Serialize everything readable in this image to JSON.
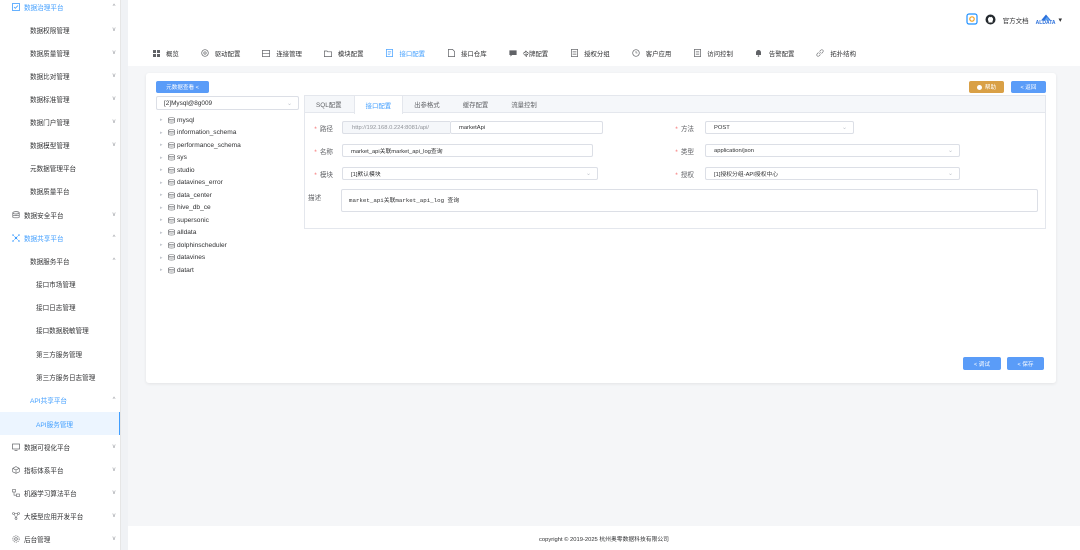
{
  "sidebar": {
    "items": [
      {
        "label": "数据治理平台",
        "icon": "checklist-icon",
        "chevron": "^"
      },
      {
        "label": "数据权限管理",
        "chevron": "v"
      },
      {
        "label": "数据质量管理",
        "chevron": "v"
      },
      {
        "label": "数据比对管理",
        "chevron": "v"
      },
      {
        "label": "数据标准管理",
        "chevron": "v"
      },
      {
        "label": "数据门户管理",
        "chevron": "v"
      },
      {
        "label": "数据模型管理",
        "chevron": "v"
      },
      {
        "label": "元数据管理平台",
        "chevron": ""
      },
      {
        "label": "数据质量平台",
        "chevron": ""
      },
      {
        "label": "数据安全平台",
        "icon": "database-icon",
        "chevron": "v"
      },
      {
        "label": "数据共享平台",
        "icon": "share-network-icon",
        "chevron": "^"
      },
      {
        "label": "数据服务平台",
        "chevron": "^"
      },
      {
        "label": "接口市场管理",
        "chevron": ""
      },
      {
        "label": "接口日志管理",
        "chevron": ""
      },
      {
        "label": "接口数据脱敏管理",
        "chevron": ""
      },
      {
        "label": "第三方服务管理",
        "chevron": ""
      },
      {
        "label": "第三方服务日志管理",
        "chevron": ""
      },
      {
        "label": "API共享平台",
        "chevron": "^"
      },
      {
        "label": "API服务管理",
        "chevron": ""
      },
      {
        "label": "数据可视化平台",
        "icon": "monitor-icon",
        "chevron": "v"
      },
      {
        "label": "指标体系平台",
        "icon": "cube-icon",
        "chevron": "v"
      },
      {
        "label": "机器学习算法平台",
        "icon": "flow-icon",
        "chevron": "v"
      },
      {
        "label": "大模型应用开发平台",
        "icon": "ai-network-icon",
        "chevron": "v"
      },
      {
        "label": "后台管理",
        "icon": "settings-icon",
        "chevron": "v"
      }
    ]
  },
  "header": {
    "docs_label": "官方文档",
    "logo_text": "ALDATA",
    "dropdown_arrow": "▾"
  },
  "tabs": [
    {
      "label": "概览"
    },
    {
      "label": "驱动配置"
    },
    {
      "label": "连接管理"
    },
    {
      "label": "模块配置"
    },
    {
      "label": "接口配置"
    },
    {
      "label": "接口仓库"
    },
    {
      "label": "令牌配置"
    },
    {
      "label": "授权分组"
    },
    {
      "label": "客户应用"
    },
    {
      "label": "访问控制"
    },
    {
      "label": "告警配置"
    },
    {
      "label": "拓扑结构"
    }
  ],
  "card": {
    "metadata_button": "元数据查看 <",
    "help_button": "帮助",
    "back_button": "< 返回",
    "datasource_select": "[2]Mysql@8g009",
    "tree": [
      "mysql",
      "information_schema",
      "performance_schema",
      "sys",
      "studio",
      "datavines_error",
      "data_center",
      "hive_db_ce",
      "supersonic",
      "alldata",
      "dolphinscheduler",
      "datavines",
      "datart"
    ],
    "inner_tabs": [
      "SQL配置",
      "接口配置",
      "出参格式",
      "缓存配置",
      "流量控制"
    ],
    "form": {
      "path_label": "路径",
      "path_prefix": "http://192.168.0.224:8081/api/",
      "path_value": "marketApi",
      "method_label": "方法",
      "method_value": "POST",
      "name_label": "名称",
      "name_value": "market_api关联market_api_log查询",
      "type_label": "类型",
      "type_value": "application/json",
      "module_label": "模块",
      "module_value": "[1]默认模块",
      "auth_label": "授权",
      "auth_value": "[1]授权分组-API授权中心",
      "desc_label": "描述",
      "desc_value": "market_api关联market_api_log 查询"
    },
    "debug_button": "< 调试",
    "save_button": "< 保存"
  },
  "footer": {
    "copyright": "copyright © 2019-2025 杭州奥零数据科技有限公司"
  }
}
